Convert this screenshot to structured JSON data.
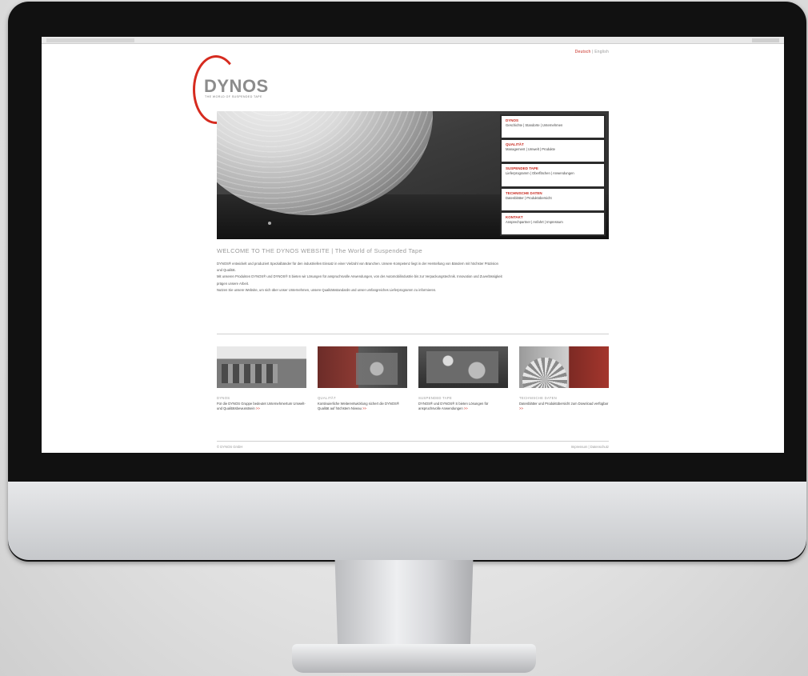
{
  "site": {
    "lang_switch": {
      "active": "Deutsch",
      "separator": "|",
      "other": "English"
    },
    "logo": {
      "text": "DYNOS",
      "sub": "THE WORLD OF SUSPENDED TAPE"
    },
    "hero_nav": [
      {
        "title": "DYNOS",
        "sub": "Geschichte | Standorte | Unternehmen"
      },
      {
        "title": "QUALITÄT",
        "sub": "Management | Umwelt | Produkte"
      },
      {
        "title": "SUSPENDED TAPE",
        "sub": "Lieferprogramm | Oberflächen | Anwendungen"
      },
      {
        "title": "TECHNISCHE DATEN",
        "sub": "Datenblätter | Produktübersicht"
      },
      {
        "title": "KONTAKT",
        "sub": "Ansprechpartner | Anfahrt | Impressum"
      }
    ],
    "intro": {
      "heading": "WELCOME TO THE DYNOS WEBSITE | The World of Suspended Tape",
      "paragraphs": [
        "DYNOS® entwickelt und produziert Spezialbänder für den industriellen Einsatz in einer Vielzahl von Branchen. Unsere Kompetenz liegt in der Herstellung von Bändern mit höchster Präzision und Qualität.",
        "Mit unseren Produkten DYNOS® und DYNOS® S bieten wir Lösungen für anspruchsvolle Anwendungen, von der Automobilindustrie bis zur Verpackungstechnik. Innovation und Zuverlässigkeit prägen unsere Arbeit.",
        "Nutzen Sie unsere Website, um sich über unser Unternehmen, unsere Qualitätsstandards und unser umfangreiches Lieferprogramm zu informieren."
      ]
    },
    "teasers": [
      {
        "title": "DYNOS",
        "text": "Für die DYNOS Gruppe bedeutet Unternehmertum Umwelt- und Qualitätsbewusstsein",
        "more": ">>"
      },
      {
        "title": "QUALITÄT",
        "text": "Kontinuierliche Weiterentwicklung sichert die DYNOS® Qualität auf höchstem Niveau",
        "more": ">>"
      },
      {
        "title": "SUSPENDED TAPE",
        "text": "DYNOS® und DYNOS® S bieten Lösungen für anspruchsvolle Anwendungen",
        "more": ">>"
      },
      {
        "title": "TECHNISCHE DATEN",
        "text": "Datenblätter und Produktübersicht zum Download verfügbar",
        "more": ">>"
      }
    ],
    "footer": {
      "left": "© DYNOS GmbH",
      "right": "Impressum | Datenschutz"
    }
  }
}
